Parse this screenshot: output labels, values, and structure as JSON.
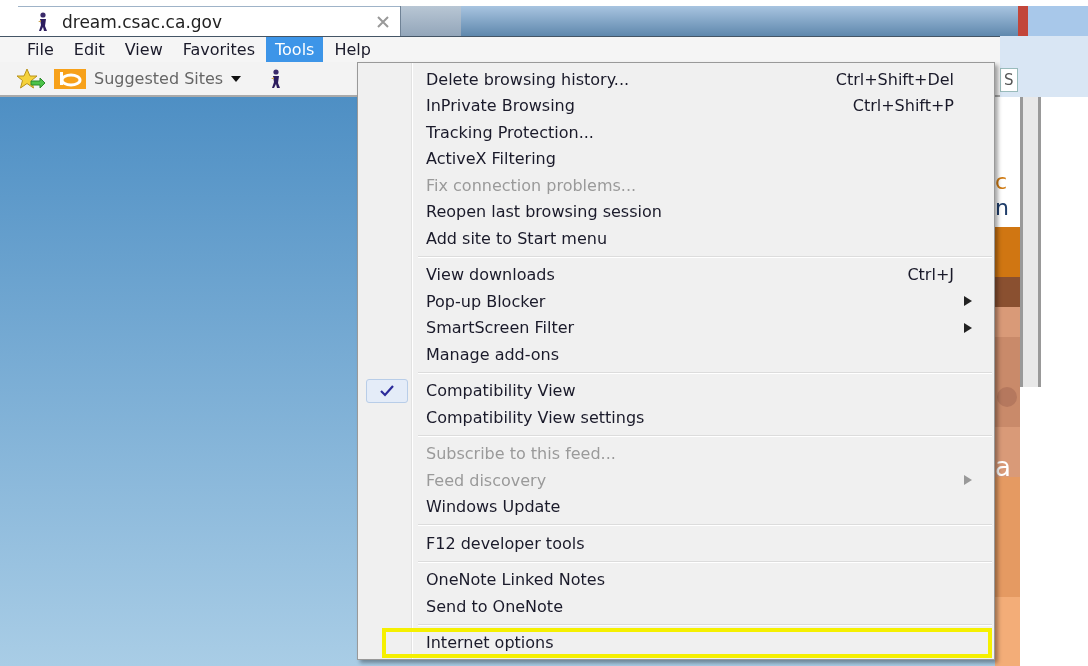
{
  "tab": {
    "title": "dream.csac.ca.gov"
  },
  "menu_bar": [
    {
      "label": "File",
      "selected": false
    },
    {
      "label": "Edit",
      "selected": false
    },
    {
      "label": "View",
      "selected": false
    },
    {
      "label": "Favorites",
      "selected": false
    },
    {
      "label": "Tools",
      "selected": true
    },
    {
      "label": "Help",
      "selected": false
    }
  ],
  "favorites_bar": {
    "label": "Suggested Sites"
  },
  "page_fragments": {
    "search_letter": "S",
    "heading_letter_1": "c",
    "heading_letter_2": "n",
    "banner_letter": "a"
  },
  "tools_menu": [
    [
      {
        "label": "Delete browsing history...",
        "shortcut": "Ctrl+Shift+Del",
        "disabled": false,
        "checked": false,
        "submenu": false,
        "highlighted": false
      },
      {
        "label": "InPrivate Browsing",
        "shortcut": "Ctrl+Shift+P",
        "disabled": false,
        "checked": false,
        "submenu": false,
        "highlighted": false
      },
      {
        "label": "Tracking Protection...",
        "disabled": false,
        "checked": false,
        "submenu": false,
        "highlighted": false
      },
      {
        "label": "ActiveX Filtering",
        "disabled": false,
        "checked": false,
        "submenu": false,
        "highlighted": false
      },
      {
        "label": "Fix connection problems...",
        "disabled": true,
        "checked": false,
        "submenu": false,
        "highlighted": false
      },
      {
        "label": "Reopen last browsing session",
        "disabled": false,
        "checked": false,
        "submenu": false,
        "highlighted": false
      },
      {
        "label": "Add site to Start menu",
        "disabled": false,
        "checked": false,
        "submenu": false,
        "highlighted": false
      }
    ],
    [
      {
        "label": "View downloads",
        "shortcut": "Ctrl+J",
        "disabled": false,
        "checked": false,
        "submenu": false,
        "highlighted": false
      },
      {
        "label": "Pop-up Blocker",
        "disabled": false,
        "checked": false,
        "submenu": true,
        "highlighted": false
      },
      {
        "label": "SmartScreen Filter",
        "disabled": false,
        "checked": false,
        "submenu": true,
        "highlighted": false
      },
      {
        "label": "Manage add-ons",
        "disabled": false,
        "checked": false,
        "submenu": false,
        "highlighted": false
      }
    ],
    [
      {
        "label": "Compatibility View",
        "disabled": false,
        "checked": true,
        "submenu": false,
        "highlighted": false
      },
      {
        "label": "Compatibility View settings",
        "disabled": false,
        "checked": false,
        "submenu": false,
        "highlighted": false
      }
    ],
    [
      {
        "label": "Subscribe to this feed...",
        "disabled": true,
        "checked": false,
        "submenu": false,
        "highlighted": false
      },
      {
        "label": "Feed discovery",
        "disabled": true,
        "checked": false,
        "submenu": true,
        "highlighted": false
      },
      {
        "label": "Windows Update",
        "disabled": false,
        "checked": false,
        "submenu": false,
        "highlighted": false
      }
    ],
    [
      {
        "label": "F12 developer tools",
        "disabled": false,
        "checked": false,
        "submenu": false,
        "highlighted": false
      }
    ],
    [
      {
        "label": "OneNote Linked Notes",
        "disabled": false,
        "checked": false,
        "submenu": false,
        "highlighted": false
      },
      {
        "label": "Send to OneNote",
        "disabled": false,
        "checked": false,
        "submenu": false,
        "highlighted": false
      }
    ],
    [
      {
        "label": "Internet options",
        "disabled": false,
        "checked": false,
        "submenu": false,
        "highlighted": true
      }
    ]
  ]
}
